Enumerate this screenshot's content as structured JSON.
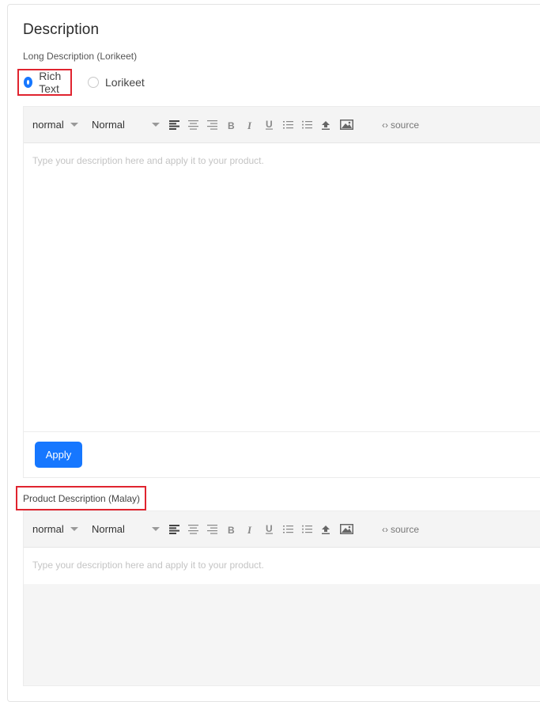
{
  "section": {
    "title": "Description",
    "long_label": "Long Description (Lorikeet)",
    "radios": [
      {
        "label": "Rich Text",
        "checked": true
      },
      {
        "label": "Lorikeet",
        "checked": false
      }
    ]
  },
  "editor1": {
    "font_select": "normal",
    "style_select": "Normal",
    "source_label": "source",
    "placeholder": "Type your description here and apply it to your product.",
    "apply_label": "Apply"
  },
  "editor2": {
    "label": "Product Description (Malay)",
    "font_select": "normal",
    "style_select": "Normal",
    "source_label": "source",
    "placeholder": "Type your description here and apply it to your product."
  },
  "toolbar_icons": [
    "align-left-icon",
    "align-center-icon",
    "align-right-icon",
    "bold-icon",
    "italic-icon",
    "underline-icon",
    "ordered-list-icon",
    "bullet-list-icon",
    "upload-icon",
    "image-icon",
    "code-icon"
  ],
  "colors": {
    "accent": "#1677ff",
    "highlight": "#e0242f"
  }
}
